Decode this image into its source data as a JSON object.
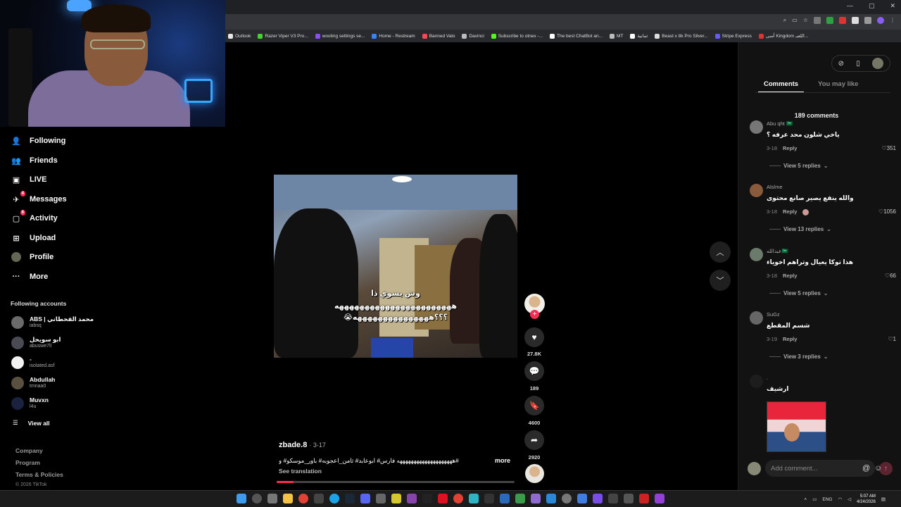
{
  "browser": {
    "bookmarks": [
      {
        "label": "Outlook",
        "color": "#e6e6e6"
      },
      {
        "label": "Razer Viper V3 Pro...",
        "color": "#44d62c"
      },
      {
        "label": "wooting settings se...",
        "color": "#8a4dff"
      },
      {
        "label": "Home - Restream",
        "color": "#3b82f6"
      },
      {
        "label": "Banned Valo",
        "color": "#ff4655"
      },
      {
        "label": "Davinci",
        "color": "#bbbbbb"
      },
      {
        "label": "Subscribe to otnex -...",
        "color": "#53fc18"
      },
      {
        "label": "The best ChatBot an...",
        "color": "#ffffff"
      },
      {
        "label": "MT",
        "color": "#bbbbbb"
      },
      {
        "label": "ثمانية",
        "color": "#ffffff"
      },
      {
        "label": "Beast x 8k Pro Silver...",
        "color": "#dddddd"
      },
      {
        "label": "Stripe Express",
        "color": "#635bff"
      },
      {
        "label": "أسى Kingdom اللعبـ...",
        "color": "#d33"
      }
    ]
  },
  "sidebar": {
    "items": [
      {
        "label": "Following",
        "icon": "following-icon",
        "badge": ""
      },
      {
        "label": "Friends",
        "icon": "friends-icon",
        "badge": ""
      },
      {
        "label": "LIVE",
        "icon": "live-icon",
        "badge": ""
      },
      {
        "label": "Messages",
        "icon": "messages-icon",
        "badge": "4"
      },
      {
        "label": "Activity",
        "icon": "activity-icon",
        "badge": "6"
      },
      {
        "label": "Upload",
        "icon": "upload-icon",
        "badge": ""
      },
      {
        "label": "Profile",
        "icon": "profile-icon",
        "badge": ""
      },
      {
        "label": "More",
        "icon": "more-icon",
        "badge": ""
      }
    ],
    "following_title": "Following accounts",
    "accounts": [
      {
        "name": "ABS | محمد القحطاني",
        "user": "iabsq",
        "color": "#6b6b6b"
      },
      {
        "name": "ابو سويحل",
        "user": "abuswe7ll",
        "color": "#4a4a55"
      },
      {
        "name": "-",
        "user": "isolated.asf",
        "color": "#f2f2f2"
      },
      {
        "name": "Abdullah",
        "user": "tmnaa0",
        "color": "#5a5040"
      },
      {
        "name": "Muvxn",
        "user": "l4u",
        "color": "#1a2240"
      }
    ],
    "view_all": "View all",
    "footer": [
      "Company",
      "Program",
      "Terms & Policies"
    ],
    "copyright": "© 2026 TikTok"
  },
  "video": {
    "caption_top": "وش يسوي ذا",
    "caption_mid": "هههههههههههههههههههههههه",
    "caption_bottom": "😭؟؟؟هههههههههههههههه",
    "author": "zbade.8",
    "date": "· 3-17",
    "description": "#ههههههههههههههههههههه فارس# ابوعابد# ثامن_اعجوبه# باور_موسكو# و",
    "more": "more",
    "see_translation": "See translation",
    "progress": 0.07
  },
  "actions": {
    "likes": "27.8K",
    "comments": "189",
    "saves": "4600",
    "shares": "2920"
  },
  "comments_panel": {
    "tab_comments": "Comments",
    "tab_you_may_like": "You may like",
    "count": "189 comments",
    "comments": [
      {
        "user": "Abu qht 🇸🇦",
        "text": "ياخي شلون محد عرفه ؟",
        "date": "3-18",
        "likes": "351",
        "replies": "View 5 replies"
      },
      {
        "user": "Alslme",
        "text": "والله ينفع يصير صانع محتوى",
        "date": "3-18",
        "likes": "1056",
        "replies": "View 13 replies"
      },
      {
        "user": "عبدالله🇸🇦",
        "text": "هذا توكا يعيال وتراهم اخوياء",
        "date": "3-18",
        "likes": "66",
        "replies": "View 5 replies"
      },
      {
        "user": "SuGz",
        "text": "شسم المقطع",
        "date": "3-19",
        "likes": "1",
        "replies": "View 3 replies"
      },
      {
        "user": ".",
        "text": "ارشيف",
        "date": "",
        "likes": "",
        "replies": ""
      }
    ],
    "reply_label": "Reply",
    "add_comment_placeholder": "Add comment..."
  },
  "taskbar": {
    "lang": "ENG",
    "time": "5:07 AM",
    "date": "4/24/2026"
  }
}
